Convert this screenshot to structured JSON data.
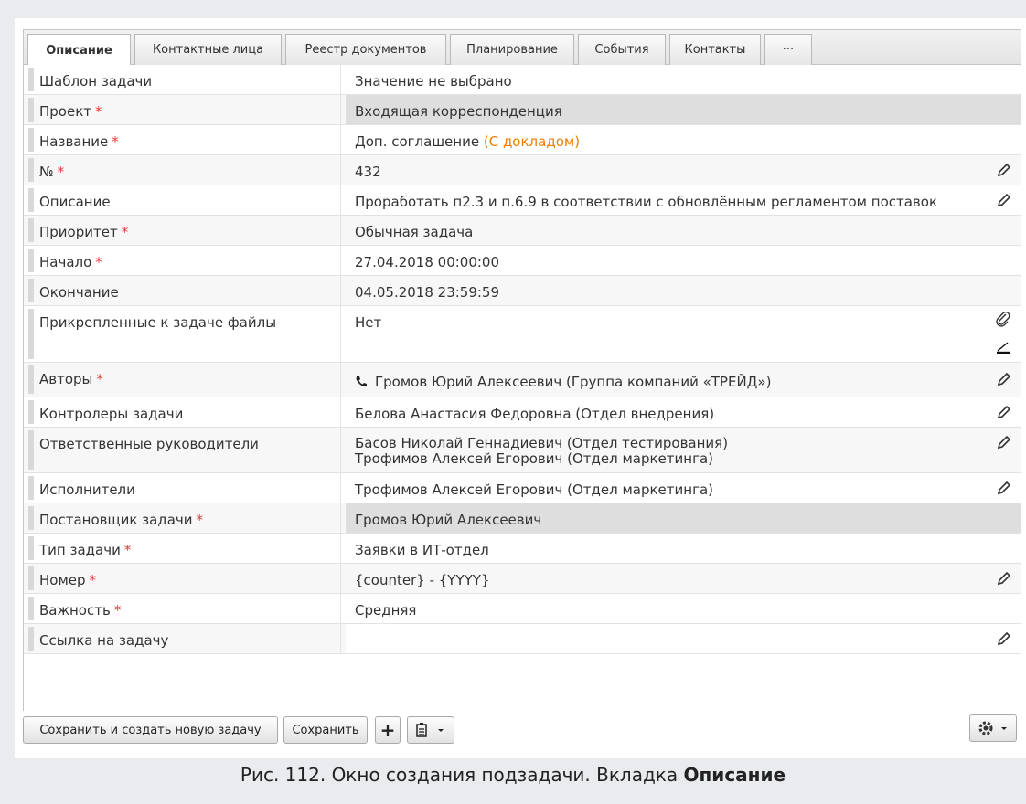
{
  "tabs": [
    "Описание",
    "Контактные лица",
    "Реестр документов",
    "Планирование",
    "События",
    "Контакты",
    "···"
  ],
  "fields": [
    {
      "label": "Шаблон задачи",
      "required": false,
      "value": "Значение не выбрано"
    },
    {
      "label": "Проект",
      "required": true,
      "value": "Входящая корреспонденция"
    },
    {
      "label": "Название",
      "required": true,
      "value": "Доп. соглашение",
      "value_suffix": "(С докладом)"
    },
    {
      "label": "№",
      "required": true,
      "value": "432"
    },
    {
      "label": "Описание",
      "required": false,
      "value": "Проработать п2.3 и п.6.9 в соответствии с обновлённым регламентом поставок"
    },
    {
      "label": "Приоритет",
      "required": true,
      "value": "Обычная задача"
    },
    {
      "label": "Начало",
      "required": true,
      "value": "27.04.2018 00:00:00"
    },
    {
      "label": "Окончание",
      "required": false,
      "value": "04.05.2018 23:59:59"
    },
    {
      "label": "Прикрепленные к задаче файлы",
      "required": false,
      "value": "Нет"
    },
    {
      "label": "Авторы",
      "required": true,
      "value": "Громов Юрий Алексеевич (Группа компаний «ТРЕЙД»)"
    },
    {
      "label": "Контролеры задачи",
      "required": false,
      "value": "Белова Анастасия Федоровна (Отдел внедрения)"
    },
    {
      "label": "Ответственные руководители",
      "required": false,
      "value": "Басов Николай Геннадиевич (Отдел тестирования)",
      "value_line2": "Трофимов Алексей Егорович (Отдел маркетинга)"
    },
    {
      "label": "Исполнители",
      "required": false,
      "value": "Трофимов Алексей Егорович (Отдел маркетинга)"
    },
    {
      "label": "Постановщик задачи",
      "required": true,
      "value": "Громов Юрий Алексеевич"
    },
    {
      "label": "Тип задачи",
      "required": true,
      "value": "Заявки в ИТ-отдел"
    },
    {
      "label": "Номер",
      "required": true,
      "value": "{counter} - {YYYY}"
    },
    {
      "label": "Важность",
      "required": true,
      "value": "Средняя"
    },
    {
      "label": "Ссылка на задачу",
      "required": false,
      "value": ""
    }
  ],
  "required_mark": "*",
  "buttons": {
    "save_and_new": "Сохранить и создать новую задачу",
    "save": "Сохранить",
    "add": "+"
  },
  "icons": [
    "pencil-icon",
    "paperclip-icon",
    "signature-icon",
    "phone-icon",
    "plus-icon",
    "clipboard-icon",
    "gear-icon",
    "chevron-down-icon"
  ],
  "caption": {
    "text": "Рис. 112. Окно создания подзадачи. Вкладка ",
    "bold": "Описание"
  }
}
